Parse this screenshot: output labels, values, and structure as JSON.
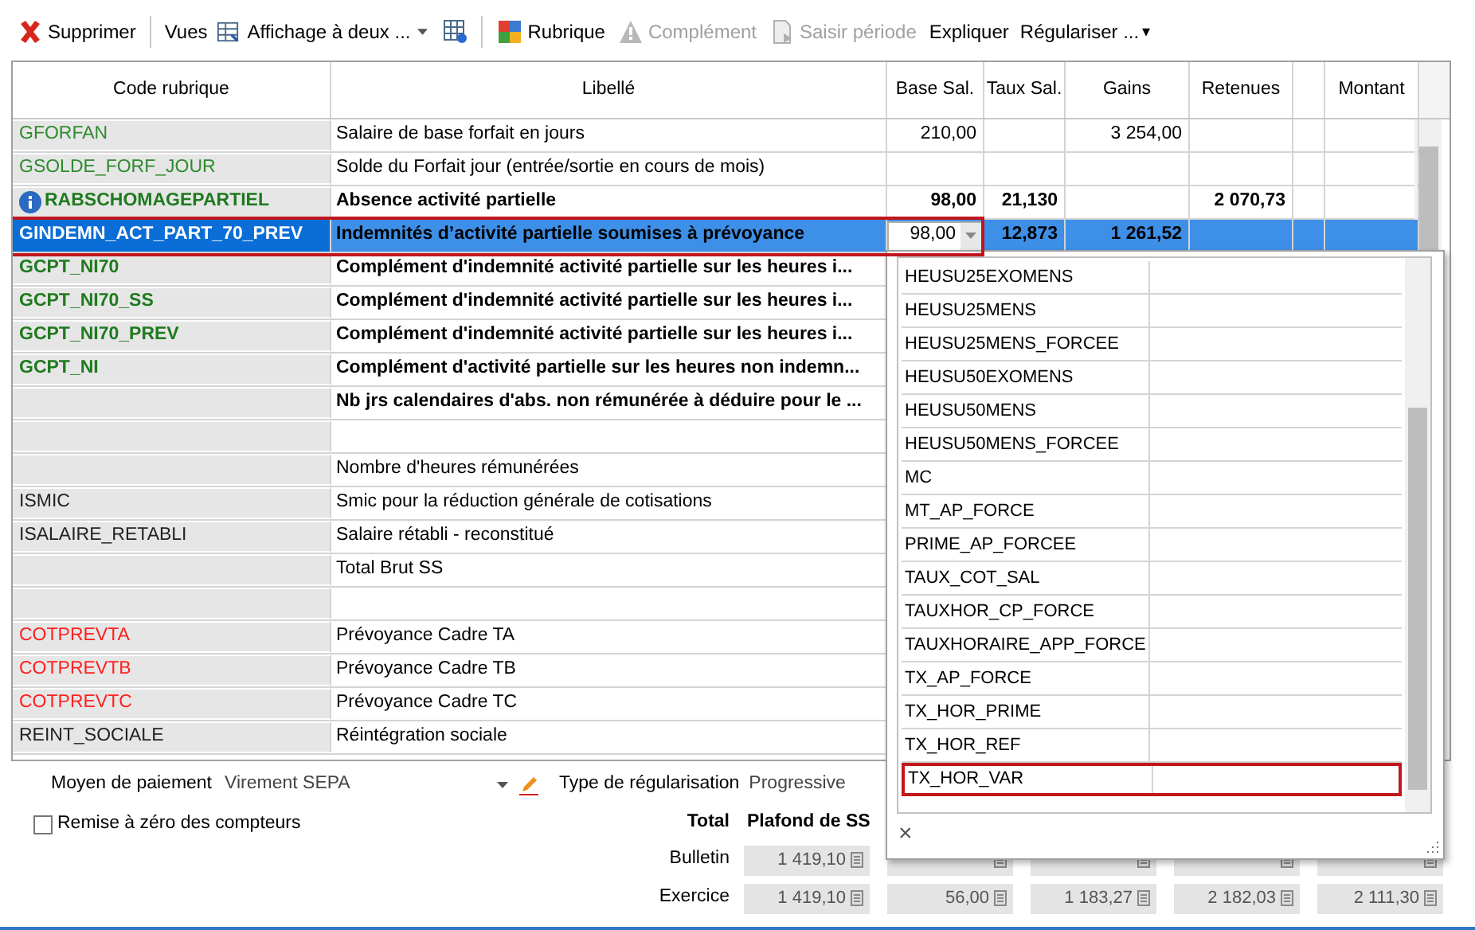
{
  "toolbar": [
    {
      "kind": "button",
      "label": "Supprimer",
      "disabled": false
    },
    {
      "kind": "label",
      "label": "Vues"
    },
    {
      "kind": "dropdown",
      "label": "Affichage à deux ..."
    },
    {
      "kind": "icon"
    },
    {
      "kind": "button",
      "label": "Rubrique",
      "disabled": false
    },
    {
      "kind": "button",
      "label": "Complément",
      "disabled": true
    },
    {
      "kind": "button",
      "label": "Saisir période",
      "disabled": true
    },
    {
      "kind": "button",
      "label": "Expliquer",
      "disabled": false
    },
    {
      "kind": "menu",
      "label": "Régulariser ...",
      "caret": "▾"
    }
  ],
  "table": {
    "columns": [
      "Code rubrique",
      "Libellé",
      "Base Sal.",
      "Taux Sal.",
      "Gains",
      "Retenues",
      "",
      "Montant"
    ],
    "rows": [
      {
        "code": "GFORFAN",
        "kind": "gain",
        "bold": false,
        "info": false,
        "selected": false,
        "highlighted": false,
        "label": "Salaire de base forfait en jours",
        "base": "210,00",
        "taux": "",
        "gains": "3 254,00",
        "retenues": ""
      },
      {
        "code": "GSOLDE_FORF_JOUR",
        "kind": "gain",
        "bold": false,
        "info": false,
        "selected": false,
        "highlighted": false,
        "label": "Solde du Forfait jour (entrée/sortie en cours de mois)",
        "base": "",
        "taux": "",
        "gains": "",
        "retenues": ""
      },
      {
        "code": "RABSCHOMAGEPARTIEL",
        "kind": "gain",
        "bold": true,
        "info": true,
        "selected": false,
        "highlighted": false,
        "label": "Absence activité partielle",
        "base": "98,00",
        "taux": "21,130",
        "gains": "",
        "retenues": "2 070,73"
      },
      {
        "code": "GINDEMN_ACT_PART_70_PREV",
        "bold": true,
        "info": false,
        "selected": true,
        "highlighted": true,
        "label": "Indemnités d’activité partielle soumises à prévoyance",
        "base": "98,00",
        "taux": "12,873",
        "gains": "1 261,52",
        "retenues": ""
      },
      {
        "code": "GCPT_NI70",
        "kind": "gain",
        "bold": true,
        "info": false,
        "selected": false,
        "highlighted": false,
        "label": "Complément d'indemnité activité partielle sur les heures i...",
        "base": "",
        "taux": "",
        "gains": "",
        "retenues": ""
      },
      {
        "code": "GCPT_NI70_SS",
        "kind": "gain",
        "bold": true,
        "info": false,
        "selected": false,
        "highlighted": false,
        "label": "Complément d'indemnité activité partielle sur les heures i...",
        "base": "",
        "taux": "",
        "gains": "",
        "retenues": ""
      },
      {
        "code": "GCPT_NI70_PREV",
        "kind": "gain",
        "bold": true,
        "info": false,
        "selected": false,
        "highlighted": false,
        "label": "Complément d'indemnité activité partielle sur les heures i...",
        "base": "",
        "taux": "",
        "gains": "",
        "retenues": ""
      },
      {
        "code": "GCPT_NI",
        "kind": "gain",
        "bold": true,
        "info": false,
        "selected": false,
        "highlighted": false,
        "label": "Complément d'activité partielle sur les heures non indemn...",
        "base": "",
        "taux": "",
        "gains": "",
        "retenues": ""
      },
      {
        "code": "",
        "kind": "other",
        "bold": true,
        "info": false,
        "selected": false,
        "highlighted": false,
        "label": "Nb jrs calendaires d'abs. non rémunérée à déduire pour le ...",
        "base": "",
        "taux": "",
        "gains": "",
        "retenues": ""
      },
      {
        "code": "",
        "kind": "other",
        "info": false,
        "selected": false,
        "label": "",
        "base": "",
        "taux": "",
        "gains": "",
        "retenues": ""
      },
      {
        "code": "",
        "kind": "other",
        "bold": false,
        "info": false,
        "selected": false,
        "highlighted": false,
        "label": "Nombre d'heures rémunérées",
        "base": "",
        "taux": "",
        "gains": "",
        "retenues": ""
      },
      {
        "code": "ISMIC",
        "kind": "other",
        "bold": false,
        "info": false,
        "selected": false,
        "highlighted": false,
        "label": "Smic pour la réduction générale de cotisations",
        "base": "",
        "taux": "",
        "gains": "",
        "retenues": ""
      },
      {
        "code": "ISALAIRE_RETABLI",
        "kind": "other",
        "bold": false,
        "info": false,
        "selected": false,
        "highlighted": false,
        "label": "Salaire rétabli - reconstitué",
        "base": "",
        "taux": "",
        "gains": "",
        "retenues": ""
      },
      {
        "code": "",
        "kind": "other",
        "bold": false,
        "info": false,
        "selected": false,
        "highlighted": false,
        "label": "Total Brut SS",
        "base": "",
        "taux": "",
        "gains": "",
        "retenues": ""
      },
      {
        "code": "",
        "kind": "other",
        "info": false,
        "selected": false,
        "label": "",
        "base": "",
        "taux": "",
        "gains": "",
        "retenues": ""
      },
      {
        "code": "COTPREVTA",
        "kind": "cotisation",
        "bold": false,
        "info": false,
        "selected": false,
        "highlighted": false,
        "label": "Prévoyance Cadre TA",
        "base": "",
        "taux": "",
        "gains": "",
        "retenues": ""
      },
      {
        "code": "COTPREVTB",
        "kind": "cotisation",
        "bold": false,
        "info": false,
        "selected": false,
        "highlighted": false,
        "label": "Prévoyance Cadre TB",
        "base": "",
        "taux": "",
        "gains": "",
        "retenues": ""
      },
      {
        "code": "COTPREVTC",
        "kind": "cotisation",
        "bold": false,
        "info": false,
        "selected": false,
        "highlighted": false,
        "label": "Prévoyance Cadre TC",
        "base": "",
        "taux": "",
        "gains": "",
        "retenues": ""
      },
      {
        "code": "REINT_SOCIALE",
        "kind": "other",
        "bold": false,
        "info": false,
        "selected": false,
        "highlighted": false,
        "label": "Réintégration sociale",
        "base": "",
        "taux": "",
        "gains": "",
        "retenues": ""
      }
    ]
  },
  "popup": {
    "items": [
      {
        "label": "HEUSU25EXOMENS",
        "highlighted": false
      },
      {
        "label": "HEUSU25MENS",
        "highlighted": false
      },
      {
        "label": "HEUSU25MENS_FORCEE",
        "highlighted": false
      },
      {
        "label": "HEUSU50EXOMENS",
        "highlighted": false
      },
      {
        "label": "HEUSU50MENS",
        "highlighted": false
      },
      {
        "label": "HEUSU50MENS_FORCEE",
        "highlighted": false
      },
      {
        "label": "MC",
        "highlighted": false
      },
      {
        "label": "MT_AP_FORCE",
        "highlighted": false
      },
      {
        "label": "PRIME_AP_FORCEE",
        "highlighted": false
      },
      {
        "label": "TAUX_COT_SAL",
        "highlighted": false
      },
      {
        "label": "TAUXHOR_CP_FORCE",
        "highlighted": false
      },
      {
        "label": "TAUXHORAIRE_APP_FORCE",
        "highlighted": false
      },
      {
        "label": "TX_AP_FORCE",
        "highlighted": false
      },
      {
        "label": "TX_HOR_PRIME",
        "highlighted": false
      },
      {
        "label": "TX_HOR_REF",
        "highlighted": false
      },
      {
        "label": "TX_HOR_VAR",
        "highlighted": true
      }
    ],
    "close": "×"
  },
  "footer": {
    "payment_label": "Moyen de paiement",
    "payment_value": "Virement SEPA",
    "regul_label": "Type de régularisation",
    "regul_value": "Progressive",
    "reset": {
      "label": "Remise à zéro des compteurs",
      "checked": false
    },
    "total_label": "Total",
    "plafond_label": "Plafond de SS",
    "rows": [
      {
        "label": "Bulletin",
        "values": [
          "1 419,10"
        ]
      },
      {
        "label": "Exercice",
        "values": [
          "1 419,10",
          "56,00",
          "1 183,27",
          "2 182,03",
          "2 111,30"
        ]
      }
    ]
  }
}
